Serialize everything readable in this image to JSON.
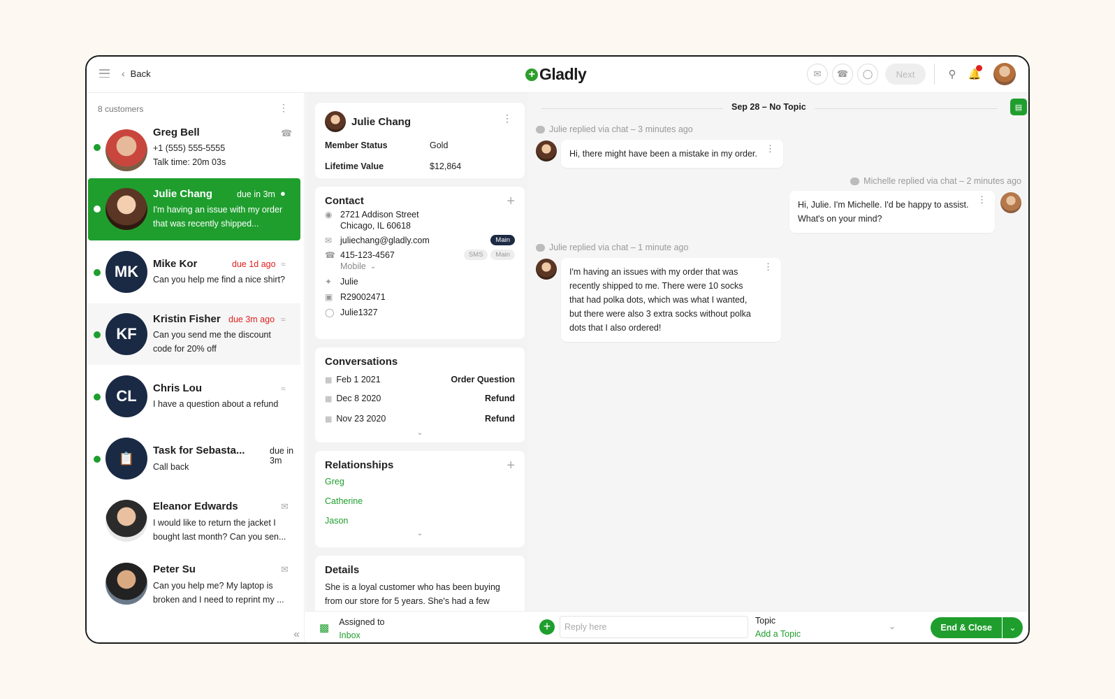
{
  "header": {
    "back_label": "Back",
    "logo_text": "Gladly",
    "next_label": "Next"
  },
  "customers": {
    "count_label": "8 customers",
    "items": [
      {
        "name": "Greg Bell",
        "line1": "+1 (555) 555-5555",
        "line2": "Talk time: 20m 03s",
        "due": "",
        "channel": "phone-icon",
        "initials": ""
      },
      {
        "name": "Julie Chang",
        "line1": "I'm having an issue with my order",
        "line2": "that was recently shipped...",
        "due": "due in 3m",
        "channel": "chat-icon",
        "initials": ""
      },
      {
        "name": "Mike Kor",
        "line1": "Can you help me find a nice shirt?",
        "line2": "",
        "due": "due 1d ago",
        "channel": "wifi-icon",
        "initials": "MK"
      },
      {
        "name": "Kristin Fisher",
        "line1": "Can you send me the discount",
        "line2": "code for 20% off",
        "due": "due 3m ago",
        "channel": "wifi-icon",
        "initials": "KF"
      },
      {
        "name": "Chris Lou",
        "line1": "I have a question about a refund",
        "line2": "",
        "due": "",
        "channel": "wifi-icon",
        "initials": "CL"
      },
      {
        "name": "Task for Sebasta...",
        "line1": "Call back",
        "line2": "",
        "due": "due in 3m",
        "channel": "",
        "initials": ""
      },
      {
        "name": "Eleanor Edwards",
        "line1": "I would like to return the jacket I",
        "line2": "bought last month? Can you sen...",
        "due": "",
        "channel": "email-icon",
        "initials": ""
      },
      {
        "name": "Peter Su",
        "line1": "Can you help me? My laptop is",
        "line2": "broken and I need to reprint my ...",
        "due": "",
        "channel": "email-icon",
        "initials": ""
      }
    ]
  },
  "profile": {
    "name": "Julie Chang",
    "member_status_label": "Member Status",
    "member_status": "Gold",
    "lifetime_value_label": "Lifetime Value",
    "lifetime_value": "$12,864"
  },
  "contact": {
    "title": "Contact",
    "address1": "2721 Addison Street",
    "address2": "Chicago, IL 60618",
    "email": "juliechang@gladly.com",
    "email_tag": "Main",
    "phone": "415-123-4567",
    "phone_tag1": "SMS",
    "phone_tag2": "Main",
    "phone_type": "Mobile",
    "twitter": "Julie",
    "facebook": "R29002471",
    "instagram": "Julie1327"
  },
  "conversations": {
    "title": "Conversations",
    "items": [
      {
        "date": "Feb 1 2021",
        "topic": "Order Question"
      },
      {
        "date": "Dec 8 2020",
        "topic": "Refund"
      },
      {
        "date": "Nov 23 2020",
        "topic": "Refund"
      }
    ]
  },
  "relationships": {
    "title": "Relationships",
    "items": [
      "Greg",
      "Catherine",
      "Jason"
    ]
  },
  "details": {
    "title": "Details",
    "line1": "She is a loyal customer who has been buying",
    "line2": "from our store for 5 years. She's had a few"
  },
  "chat": {
    "date_label": "Sep 28 – No Topic",
    "messages": [
      {
        "meta": "Julie replied via chat – 3 minutes ago",
        "lines": [
          "Hi, there might have been a mistake in my order."
        ]
      },
      {
        "meta": "Michelle replied via chat – 2 minutes ago",
        "lines": [
          "Hi, Julie. I'm Michelle. I'd be happy to assist.",
          "What's on your mind?"
        ]
      },
      {
        "meta": "Julie replied via chat – 1 minute ago",
        "lines": [
          "I'm having an issues with my order that was",
          "recently shipped to me. There were 10 socks",
          "that had polka dots, which was what I wanted,",
          "but there were also 3 extra socks without polka",
          "dots that I also ordered!"
        ]
      }
    ]
  },
  "footer": {
    "assigned_label": "Assigned to",
    "assigned_value": "Inbox",
    "reply_placeholder": "Reply here",
    "topic_label": "Topic",
    "topic_value": "Add a Topic",
    "end_label": "End & Close"
  },
  "colors": {
    "brand_green": "#1f9e2e",
    "navy": "#1a2a44",
    "due_red": "#e02020"
  }
}
